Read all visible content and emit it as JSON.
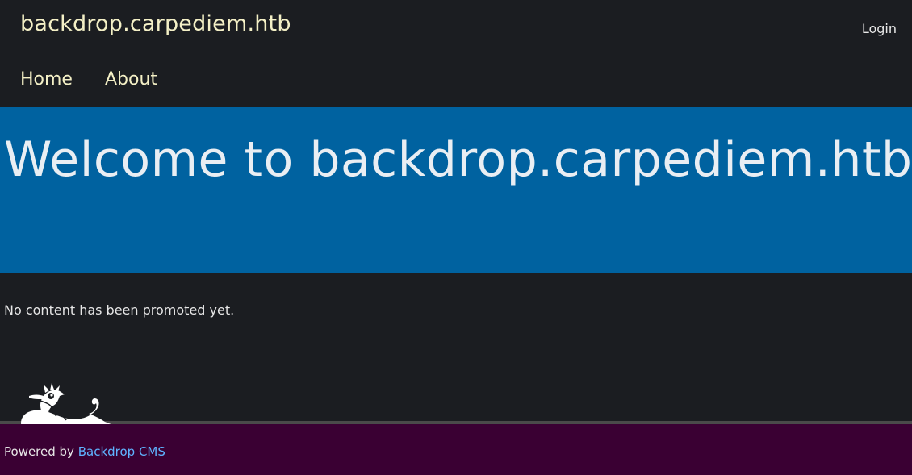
{
  "header": {
    "site_name": "backdrop.carpediem.htb",
    "login_label": "Login",
    "nav": [
      {
        "label": "Home"
      },
      {
        "label": "About"
      }
    ]
  },
  "hero": {
    "title": "Welcome to backdrop.carpediem.htb!"
  },
  "main": {
    "message": "No content has been promoted yet."
  },
  "footer": {
    "powered_prefix": "Powered by ",
    "powered_link": "Backdrop CMS"
  },
  "icons": {
    "mascot": "backdrop-dragon-logo"
  },
  "colors": {
    "header_bg": "#1b1d21",
    "site_name": "#f4f0c6",
    "hero_bg": "#0062a0",
    "footer_bg": "#3a0033",
    "link": "#5fb3ff"
  }
}
